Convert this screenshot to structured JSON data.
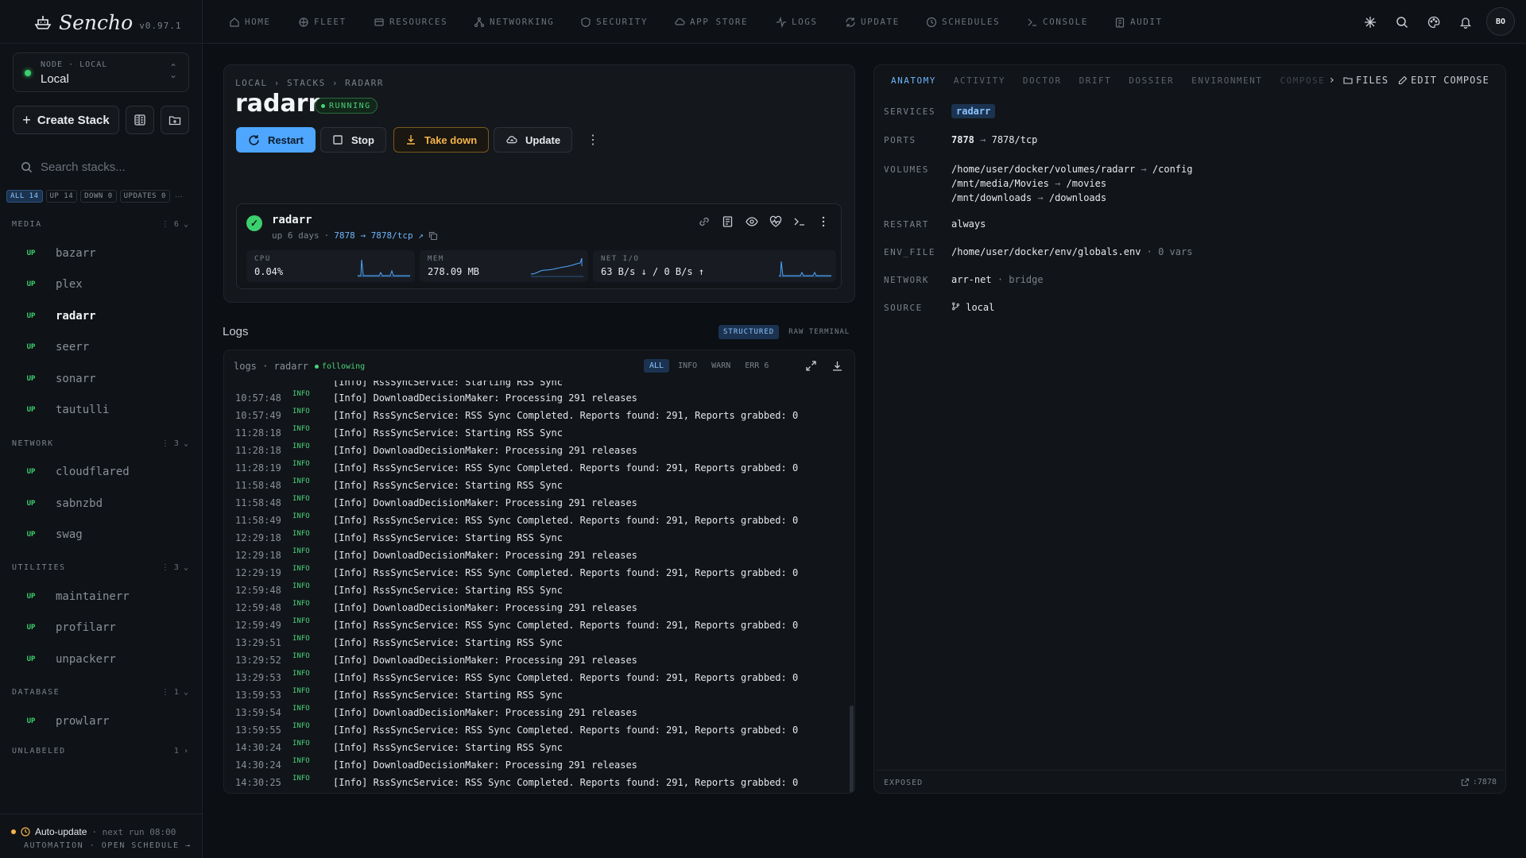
{
  "app": {
    "name": "Sencho",
    "version": "v0.97.1"
  },
  "node": {
    "label": "NODE · LOCAL",
    "value": "Local"
  },
  "sidebar": {
    "create_label": "Create Stack",
    "search_placeholder": "Search stacks...",
    "filters": [
      {
        "label": "ALL 14",
        "active": true
      },
      {
        "label": "UP 14",
        "active": false
      },
      {
        "label": "DOWN 0",
        "active": false
      },
      {
        "label": "UPDATES 0",
        "active": false
      }
    ],
    "groups": [
      {
        "name": "MEDIA",
        "count": "6",
        "items": [
          {
            "status": "UP",
            "name": "bazarr"
          },
          {
            "status": "UP",
            "name": "plex"
          },
          {
            "status": "UP",
            "name": "radarr",
            "active": true
          },
          {
            "status": "UP",
            "name": "seerr"
          },
          {
            "status": "UP",
            "name": "sonarr"
          },
          {
            "status": "UP",
            "name": "tautulli"
          }
        ]
      },
      {
        "name": "NETWORK",
        "count": "3",
        "items": [
          {
            "status": "UP",
            "name": "cloudflared"
          },
          {
            "status": "UP",
            "name": "sabnzbd"
          },
          {
            "status": "UP",
            "name": "swag"
          }
        ]
      },
      {
        "name": "UTILITIES",
        "count": "3",
        "items": [
          {
            "status": "UP",
            "name": "maintainerr"
          },
          {
            "status": "UP",
            "name": "profilarr"
          },
          {
            "status": "UP",
            "name": "unpackerr"
          }
        ]
      },
      {
        "name": "DATABASE",
        "count": "1",
        "items": [
          {
            "status": "UP",
            "name": "prowlarr"
          }
        ]
      },
      {
        "name": "UNLABELED",
        "count": "1",
        "items": []
      }
    ],
    "auto_update": {
      "label": "Auto-update",
      "next": "· next run 08:00",
      "sub": "AUTOMATION · OPEN SCHEDULE →"
    }
  },
  "topnav": [
    "HOME",
    "FLEET",
    "RESOURCES",
    "NETWORKING",
    "SECURITY",
    "APP STORE",
    "LOGS",
    "UPDATE",
    "SCHEDULES",
    "CONSOLE",
    "AUDIT"
  ],
  "user": {
    "initials": "BO"
  },
  "stack": {
    "breadcrumb": "LOCAL › STACKS › RADARR",
    "title": "radarr",
    "status": "RUNNING",
    "actions": {
      "restart": "Restart",
      "stop": "Stop",
      "take_down": "Take down",
      "update": "Update"
    }
  },
  "service": {
    "name": "radarr",
    "uptime": "up 6 days",
    "port_link": "7878 → 7878/tcp ↗",
    "metrics": [
      {
        "label": "CPU",
        "value": "0.04%"
      },
      {
        "label": "MEM",
        "value": "278.09 MB"
      },
      {
        "label": "NET I/O",
        "value": "63 B/s ↓ / 0 B/s ↑"
      }
    ]
  },
  "logs": {
    "title": "Logs",
    "mode_tabs": [
      {
        "label": "STRUCTURED",
        "active": true
      },
      {
        "label": "RAW TERMINAL",
        "active": false
      }
    ],
    "path": "logs · radarr",
    "following": "following",
    "levels": [
      {
        "label": "ALL",
        "active": true
      },
      {
        "label": "INFO"
      },
      {
        "label": "WARN"
      },
      {
        "label": "ERR 6"
      }
    ],
    "partial_top": "[Info] RssSyncService: Starting RSS Sync",
    "lines": [
      {
        "time": "10:57:48",
        "level": "INFO",
        "msg": "[Info] DownloadDecisionMaker: Processing 291 releases"
      },
      {
        "time": "10:57:49",
        "level": "INFO",
        "msg": "[Info] RssSyncService: RSS Sync Completed. Reports found: 291, Reports grabbed: 0"
      },
      {
        "time": "11:28:18",
        "level": "INFO",
        "msg": "[Info] RssSyncService: Starting RSS Sync"
      },
      {
        "time": "11:28:18",
        "level": "INFO",
        "msg": "[Info] DownloadDecisionMaker: Processing 291 releases"
      },
      {
        "time": "11:28:19",
        "level": "INFO",
        "msg": "[Info] RssSyncService: RSS Sync Completed. Reports found: 291, Reports grabbed: 0"
      },
      {
        "time": "11:58:48",
        "level": "INFO",
        "msg": "[Info] RssSyncService: Starting RSS Sync"
      },
      {
        "time": "11:58:48",
        "level": "INFO",
        "msg": "[Info] DownloadDecisionMaker: Processing 291 releases"
      },
      {
        "time": "11:58:49",
        "level": "INFO",
        "msg": "[Info] RssSyncService: RSS Sync Completed. Reports found: 291, Reports grabbed: 0"
      },
      {
        "time": "12:29:18",
        "level": "INFO",
        "msg": "[Info] RssSyncService: Starting RSS Sync"
      },
      {
        "time": "12:29:18",
        "level": "INFO",
        "msg": "[Info] DownloadDecisionMaker: Processing 291 releases"
      },
      {
        "time": "12:29:19",
        "level": "INFO",
        "msg": "[Info] RssSyncService: RSS Sync Completed. Reports found: 291, Reports grabbed: 0"
      },
      {
        "time": "12:59:48",
        "level": "INFO",
        "msg": "[Info] RssSyncService: Starting RSS Sync"
      },
      {
        "time": "12:59:48",
        "level": "INFO",
        "msg": "[Info] DownloadDecisionMaker: Processing 291 releases"
      },
      {
        "time": "12:59:49",
        "level": "INFO",
        "msg": "[Info] RssSyncService: RSS Sync Completed. Reports found: 291, Reports grabbed: 0"
      },
      {
        "time": "13:29:51",
        "level": "INFO",
        "msg": "[Info] RssSyncService: Starting RSS Sync"
      },
      {
        "time": "13:29:52",
        "level": "INFO",
        "msg": "[Info] DownloadDecisionMaker: Processing 291 releases"
      },
      {
        "time": "13:29:53",
        "level": "INFO",
        "msg": "[Info] RssSyncService: RSS Sync Completed. Reports found: 291, Reports grabbed: 0"
      },
      {
        "time": "13:59:53",
        "level": "INFO",
        "msg": "[Info] RssSyncService: Starting RSS Sync"
      },
      {
        "time": "13:59:54",
        "level": "INFO",
        "msg": "[Info] DownloadDecisionMaker: Processing 291 releases"
      },
      {
        "time": "13:59:55",
        "level": "INFO",
        "msg": "[Info] RssSyncService: RSS Sync Completed. Reports found: 291, Reports grabbed: 0"
      },
      {
        "time": "14:30:24",
        "level": "INFO",
        "msg": "[Info] RssSyncService: Starting RSS Sync"
      },
      {
        "time": "14:30:24",
        "level": "INFO",
        "msg": "[Info] DownloadDecisionMaker: Processing 291 releases"
      },
      {
        "time": "14:30:25",
        "level": "INFO",
        "msg": "[Info] RssSyncService: RSS Sync Completed. Reports found: 291, Reports grabbed: 0"
      }
    ]
  },
  "panel": {
    "tabs": [
      {
        "label": "ANATOMY",
        "active": true
      },
      {
        "label": "ACTIVITY"
      },
      {
        "label": "DOCTOR"
      },
      {
        "label": "DRIFT"
      },
      {
        "label": "DOSSIER"
      },
      {
        "label": "ENVIRONMENT"
      },
      {
        "label": "COMPOSE"
      }
    ],
    "files_label": "FILES",
    "edit_label": "EDIT COMPOSE",
    "anatomy": {
      "services_label": "SERVICES",
      "services_value": "radarr",
      "ports_label": "PORTS",
      "ports_host": "7878",
      "ports_arrow": "→",
      "ports_target": "7878/tcp",
      "volumes_label": "VOLUMES",
      "volumes": [
        {
          "src": "/home/user/docker/volumes/radarr",
          "dst": "/config"
        },
        {
          "src": "/mnt/media/Movies",
          "dst": "/movies"
        },
        {
          "src": "/mnt/downloads",
          "dst": "/downloads"
        }
      ],
      "restart_label": "RESTART",
      "restart_value": "always",
      "env_label": "ENV_FILE",
      "env_value": "/home/user/docker/env/globals.env",
      "env_vars": "· 0 vars",
      "network_label": "NETWORK",
      "network_value": "arr-net",
      "network_driver": "· bridge",
      "source_label": "SOURCE",
      "source_value": "local"
    },
    "footer_left": "EXPOSED",
    "footer_right": ":7878"
  },
  "colors": {
    "accent": "#4ea6ff",
    "up": "#3ccf6e",
    "warn": "#f5b54a",
    "bg": "#0c0f13"
  }
}
